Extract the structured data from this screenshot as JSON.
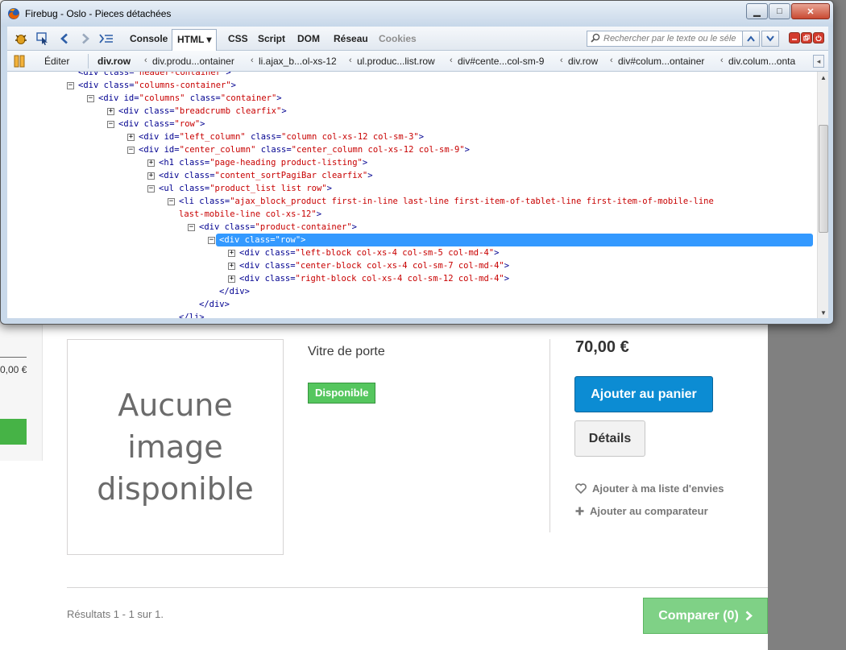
{
  "window": {
    "title": "Firebug - Oslo - Pieces détachées",
    "controls": {
      "minimize": "▁",
      "maximize": "□",
      "close": "✕"
    }
  },
  "toolbar": {
    "tabs": [
      "Console",
      "HTML",
      "CSS",
      "Script",
      "DOM",
      "Réseau",
      "Cookies"
    ],
    "active_tab": "HTML",
    "html_tab_arrow": "▾",
    "search_placeholder": "Rechercher par le texte ou le séle",
    "prev_icon": "chevron-up-icon",
    "next_icon": "chevron-down-icon"
  },
  "breadcrumb": {
    "edit_label": "Éditer",
    "items": [
      "div.row",
      "div.produ...ontainer",
      "li.ajax_b...ol-xs-12",
      "ul.produc...list.row",
      "div#cente...col-sm-9",
      "div.row",
      "div#colum...ontainer",
      "div.colum...onta"
    ]
  },
  "html_tree": [
    {
      "indent": 0,
      "toggle": "",
      "tag": "<div class=\"header-container\">",
      "partial": true
    },
    {
      "indent": 0,
      "toggle": "−",
      "tag": "<div ",
      "attrs": [
        [
          "class",
          "columns-container"
        ]
      ],
      "end": ">"
    },
    {
      "indent": 1,
      "toggle": "−",
      "tag": "<div ",
      "attrs": [
        [
          "id",
          "columns"
        ],
        [
          "class",
          "container"
        ]
      ],
      "end": ">"
    },
    {
      "indent": 2,
      "toggle": "+",
      "tag": "<div ",
      "attrs": [
        [
          "class",
          "breadcrumb clearfix"
        ]
      ],
      "end": ">"
    },
    {
      "indent": 2,
      "toggle": "−",
      "tag": "<div ",
      "attrs": [
        [
          "class",
          "row"
        ]
      ],
      "end": ">"
    },
    {
      "indent": 3,
      "toggle": "+",
      "tag": "<div ",
      "attrs": [
        [
          "id",
          "left_column"
        ],
        [
          "class",
          "column col-xs-12 col-sm-3"
        ]
      ],
      "end": ">"
    },
    {
      "indent": 3,
      "toggle": "−",
      "tag": "<div ",
      "attrs": [
        [
          "id",
          "center_column"
        ],
        [
          "class",
          "center_column col-xs-12 col-sm-9"
        ]
      ],
      "end": ">"
    },
    {
      "indent": 4,
      "toggle": "+",
      "tag": "<h1 ",
      "attrs": [
        [
          "class",
          "page-heading product-listing"
        ]
      ],
      "end": ">"
    },
    {
      "indent": 4,
      "toggle": "+",
      "tag": "<div ",
      "attrs": [
        [
          "class",
          "content_sortPagiBar clearfix"
        ]
      ],
      "end": ">"
    },
    {
      "indent": 4,
      "toggle": "−",
      "tag": "<ul ",
      "attrs": [
        [
          "class",
          "product_list list row"
        ]
      ],
      "end": ">"
    },
    {
      "indent": 5,
      "toggle": "−",
      "tag": "<li ",
      "attrs": [
        [
          "class",
          "ajax_block_product first-in-line last-line first-item-of-tablet-line first-item-of-mobile-line"
        ]
      ],
      "end": ""
    },
    {
      "indent": 5,
      "toggle": "",
      "tag": "",
      "attrs": [
        [
          "",
          "last-mobile-line col-xs-12"
        ]
      ],
      "end": ">",
      "continuation": true
    },
    {
      "indent": 6,
      "toggle": "−",
      "tag": "<div ",
      "attrs": [
        [
          "class",
          "product-container"
        ]
      ],
      "end": ">"
    },
    {
      "indent": 7,
      "toggle": "−",
      "tag": "<div ",
      "attrs": [
        [
          "class",
          "row"
        ]
      ],
      "end": ">",
      "selected": true
    },
    {
      "indent": 8,
      "toggle": "+",
      "tag": "<div ",
      "attrs": [
        [
          "class",
          "left-block col-xs-4 col-sm-5 col-md-4"
        ]
      ],
      "end": ">"
    },
    {
      "indent": 8,
      "toggle": "+",
      "tag": "<div ",
      "attrs": [
        [
          "class",
          "center-block col-xs-4 col-sm-7 col-md-4"
        ]
      ],
      "end": ">"
    },
    {
      "indent": 8,
      "toggle": "+",
      "tag": "<div ",
      "attrs": [
        [
          "class",
          "right-block col-xs-4 col-sm-12 col-md-4"
        ]
      ],
      "end": ">"
    },
    {
      "indent": 7,
      "toggle": "",
      "tag": "</div>",
      "attrs": [],
      "end": ""
    },
    {
      "indent": 6,
      "toggle": "",
      "tag": "</div>",
      "attrs": [],
      "end": ""
    },
    {
      "indent": 5,
      "toggle": "",
      "tag": "</li>",
      "attrs": [],
      "end": ""
    }
  ],
  "product": {
    "no_image_text": "Aucune\nimage\ndisponible",
    "name": "Vitre de porte",
    "availability": "Disponible",
    "price": "70,00 €",
    "add_to_cart": "Ajouter au panier",
    "details": "Détails",
    "wishlist": "Ajouter à ma liste d'envies",
    "compare": "Ajouter au comparateur"
  },
  "previous_product": {
    "price": "0,00 €"
  },
  "footer": {
    "results": "Résultats 1 - 1 sur 1.",
    "compare_button": "Comparer (0)"
  },
  "colors": {
    "accent_blue": "#0c8cd3",
    "available_green": "#55c65e",
    "compare_green": "#7fd186",
    "selection_blue": "#3399ff"
  }
}
